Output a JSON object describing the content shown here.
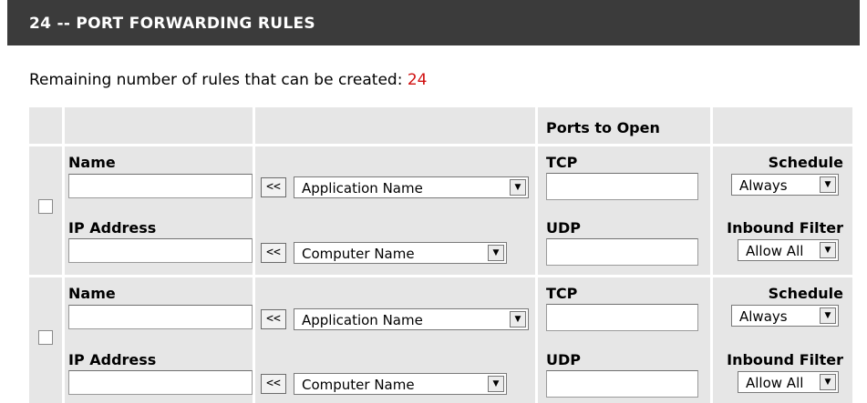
{
  "header": {
    "title": "24 -- PORT FORWARDING RULES"
  },
  "remaining": {
    "label": "Remaining number of rules that can be created:",
    "count": "24"
  },
  "table": {
    "ports_header": "Ports to Open"
  },
  "labels": {
    "name": "Name",
    "ip_address": "IP Address",
    "tcp": "TCP",
    "udp": "UDP",
    "schedule": "Schedule",
    "inbound_filter": "Inbound Filter",
    "arrow_button": "<<"
  },
  "rules": [
    {
      "checked": false,
      "name_value": "",
      "ip_value": "",
      "tcp_value": "",
      "udp_value": "",
      "application_select": "Application Name",
      "computer_select": "Computer Name",
      "schedule_select": "Always",
      "filter_select": "Allow All"
    },
    {
      "checked": false,
      "name_value": "",
      "ip_value": "",
      "tcp_value": "",
      "udp_value": "",
      "application_select": "Application Name",
      "computer_select": "Computer Name",
      "schedule_select": "Always",
      "filter_select": "Allow All"
    }
  ],
  "colors": {
    "header_bg": "#3b3b3b",
    "count_color": "#d01010",
    "grid_bg": "#e6e6e6"
  },
  "icons": {
    "dropdown": "chevron-down-icon"
  }
}
